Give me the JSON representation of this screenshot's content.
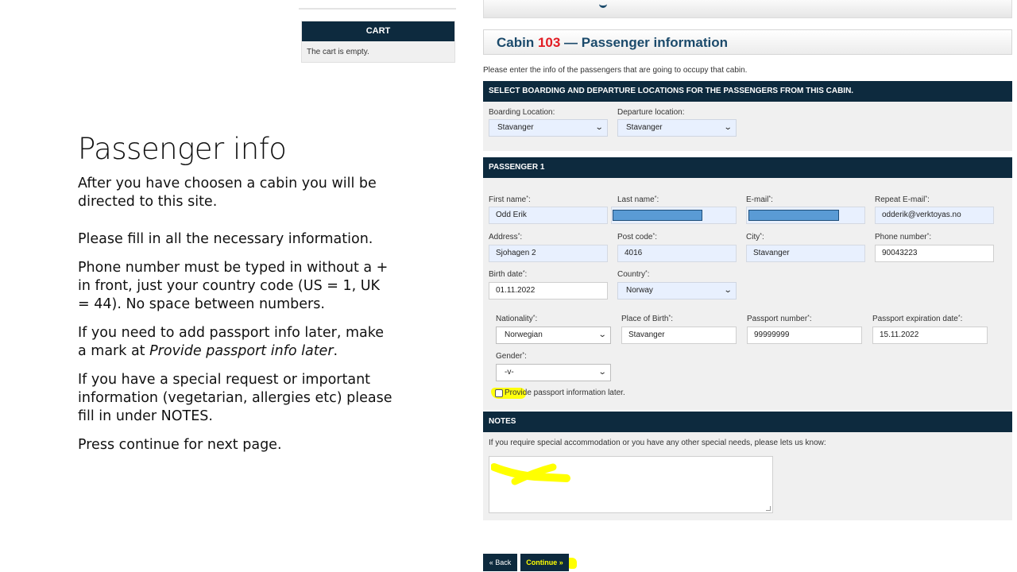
{
  "slide": {
    "title": "Passenger info",
    "paragraphs": [
      "After you have choosen a cabin you will be directed to this site.",
      "Please fill in all the necessary information.",
      "Phone number must be typed in without a + in front, just your country code (US = 1, UK = 44). No space between numbers.",
      "If you need to add passport info later, make a mark at ",
      "Provide passport info later",
      ".",
      "If you have a special request or important information (vegetarian, allergies etc) please fill in under NOTES.",
      "Press continue for next page."
    ]
  },
  "cart": {
    "header": "CART",
    "empty_text": "The cart is empty."
  },
  "cabin": {
    "prefix": "Cabin ",
    "number": "103",
    "suffix": " — Passenger information",
    "intro": "Please enter the info of the passengers that are going to occupy that cabin."
  },
  "locations": {
    "header": "SELECT BOARDING AND DEPARTURE LOCATIONS FOR THE PASSENGERS FROM THIS CABIN.",
    "boarding_label": "Boarding Location:",
    "boarding_value": "Stavanger",
    "departure_label": "Departure location:",
    "departure_value": "Stavanger"
  },
  "passenger": {
    "header": "PASSENGER 1",
    "first_name_label": "First name",
    "first_name_value": "Odd Erik",
    "last_name_label": "Last name",
    "email_label": "E-mail",
    "repeat_email_label": "Repeat E-mail",
    "repeat_email_value": "odderik@verktoyas.no",
    "address_label": "Address",
    "address_value": "Sjohagen 2",
    "post_code_label": "Post code",
    "post_code_value": "4016",
    "city_label": "City",
    "city_value": "Stavanger",
    "phone_label": "Phone number",
    "phone_value": "90043223",
    "birth_label": "Birth date",
    "birth_value": "01.11.2022",
    "country_label": "Country",
    "country_value": "Norway",
    "required_mark": "*",
    "label_suffix": ":"
  },
  "passport": {
    "nationality_label": "Nationality",
    "nationality_value": "Norwegian",
    "place_of_birth_label": "Place of Birth",
    "place_of_birth_value": "Stavanger",
    "passport_number_label": "Passport number",
    "passport_number_value": "99999999",
    "expiration_label": "Passport expiration date",
    "expiration_value": "15.11.2022",
    "gender_label": "Gender",
    "gender_value": "-v-",
    "later_label": "Provide passport information later."
  },
  "notes": {
    "header": "NOTES",
    "hint": "If you require special accommodation or you have any other special needs, please lets us know:"
  },
  "buttons": {
    "back": "« Back",
    "continue": "Continue »"
  },
  "icons": {
    "chevron": "chevron-down-icon"
  },
  "colors": {
    "header_bg": "#0d2a3e",
    "cabin_title": "#1b4a6b",
    "cabin_number": "#e21c23",
    "highlight": "#ffff00",
    "redaction": "#5a9bd5",
    "input_bg": "#e8f0fe"
  }
}
